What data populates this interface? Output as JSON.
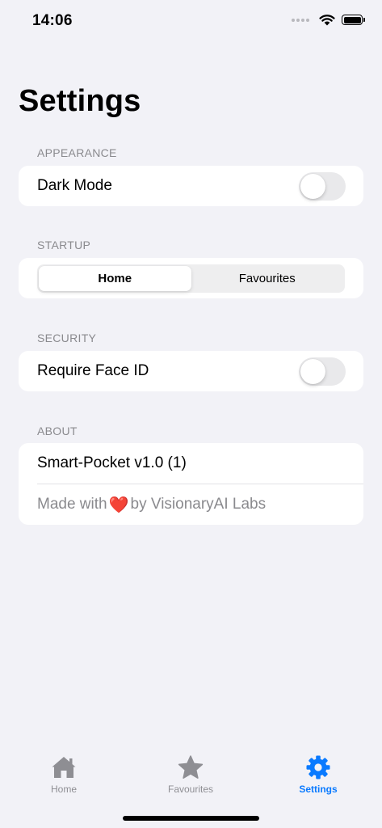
{
  "status_bar": {
    "time": "14:06"
  },
  "page_title": "Settings",
  "sections": {
    "appearance": {
      "header": "APPEARANCE",
      "dark_mode_label": "Dark Mode",
      "dark_mode_on": false
    },
    "startup": {
      "header": "STARTUP",
      "segments": [
        "Home",
        "Favourites"
      ],
      "selected": "Home"
    },
    "security": {
      "header": "SECURITY",
      "face_id_label": "Require Face ID",
      "face_id_on": false
    },
    "about": {
      "header": "ABOUT",
      "version": "Smart-Pocket v1.0 (1)",
      "made_with_prefix": "Made with",
      "heart": "❤️",
      "made_with_suffix": "by VisionaryAI Labs"
    }
  },
  "tab_bar": {
    "tabs": [
      {
        "label": "Home",
        "icon": "house-icon",
        "active": false
      },
      {
        "label": "Favourites",
        "icon": "star-icon",
        "active": false
      },
      {
        "label": "Settings",
        "icon": "gear-icon",
        "active": true
      }
    ]
  },
  "colors": {
    "accent": "#0a7aff",
    "background": "#f2f2f7",
    "inactive": "#8e8e93",
    "heart": "#e5232b"
  }
}
